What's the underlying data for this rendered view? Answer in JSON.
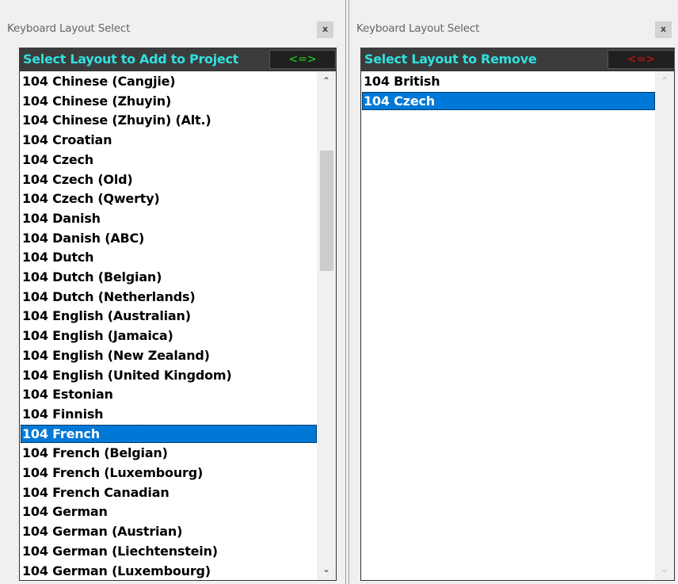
{
  "left_panel": {
    "title": "Keyboard Layout Select",
    "close_label": "x",
    "header": "Select Layout to Add to Project",
    "swap_label": "<=>",
    "swap_color": "#22dd22",
    "items": [
      "104 Chinese (Cangjie)",
      "104 Chinese (Zhuyin)",
      "104 Chinese (Zhuyin) (Alt.)",
      "104 Croatian",
      "104 Czech",
      "104 Czech (Old)",
      "104 Czech (Qwerty)",
      "104 Danish",
      "104 Danish (ABC)",
      "104 Dutch",
      "104 Dutch (Belgian)",
      "104 Dutch (Netherlands)",
      "104 English (Australian)",
      "104 English (Jamaica)",
      "104 English (New Zealand)",
      "104 English (United Kingdom)",
      "104 Estonian",
      "104 Finnish",
      "104 French",
      "104 French (Belgian)",
      "104 French (Luxembourg)",
      "104 French Canadian",
      "104 German",
      "104 German (Austrian)",
      "104 German (Liechtenstein)",
      "104 German (Luxembourg)"
    ],
    "selected": "104 French",
    "scroll_up_icon": "chevron-up-icon",
    "scroll_down_icon": "chevron-down-icon"
  },
  "right_panel": {
    "title": "Keyboard Layout Select",
    "close_label": "x",
    "header": "Select Layout to Remove",
    "swap_label": "<=>",
    "swap_color": "#dd1111",
    "items": [
      "104 British",
      "104 Czech"
    ],
    "selected": "104 Czech",
    "scroll_up_icon": "chevron-up-icon",
    "scroll_down_icon": "chevron-down-icon"
  },
  "colors": {
    "header_bg": "#3c3c3c",
    "header_text": "#30e0e0",
    "selection": "#0078d7"
  }
}
